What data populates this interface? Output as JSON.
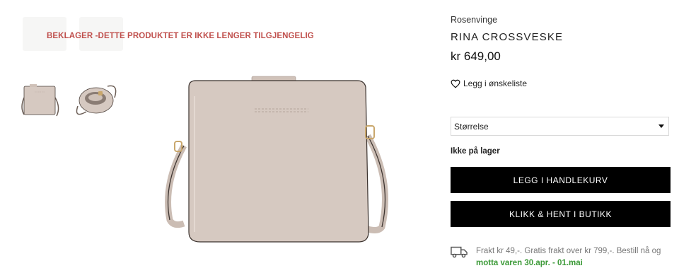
{
  "notice": {
    "unavailable": "BEKLAGER -DETTE PRODUKTET ER IKKE LENGER TILGJENGELIG"
  },
  "gallery": {
    "thumbnails": [
      {
        "icon": "bag-front-thumbnail"
      },
      {
        "icon": "bag-open-thumbnail"
      }
    ],
    "main_image": {
      "icon": "crossbody-bag-image",
      "color": "#d6c9c1"
    }
  },
  "product": {
    "brand": "Rosenvinge",
    "title": "RINA CROSSVESKE",
    "price": "kr 649,00",
    "wishlist_label": "Legg i ønskeliste",
    "size_select": {
      "selected": "Størrelse"
    },
    "stock_status": "Ikke på lager",
    "add_to_cart_label": "LEGG I HANDLEKURV",
    "click_collect_label": "KLIKK & HENT I BUTIKK"
  },
  "shipping": {
    "icon": "truck-icon",
    "text": "Frakt kr 49,-. Gratis frakt over kr 799,-. Bestill nå og",
    "delivery": "motta varen 30.apr. - 01.mai"
  },
  "colors": {
    "notice": "#c0504d",
    "button": "#000000",
    "delivery": "#3c9a38"
  }
}
